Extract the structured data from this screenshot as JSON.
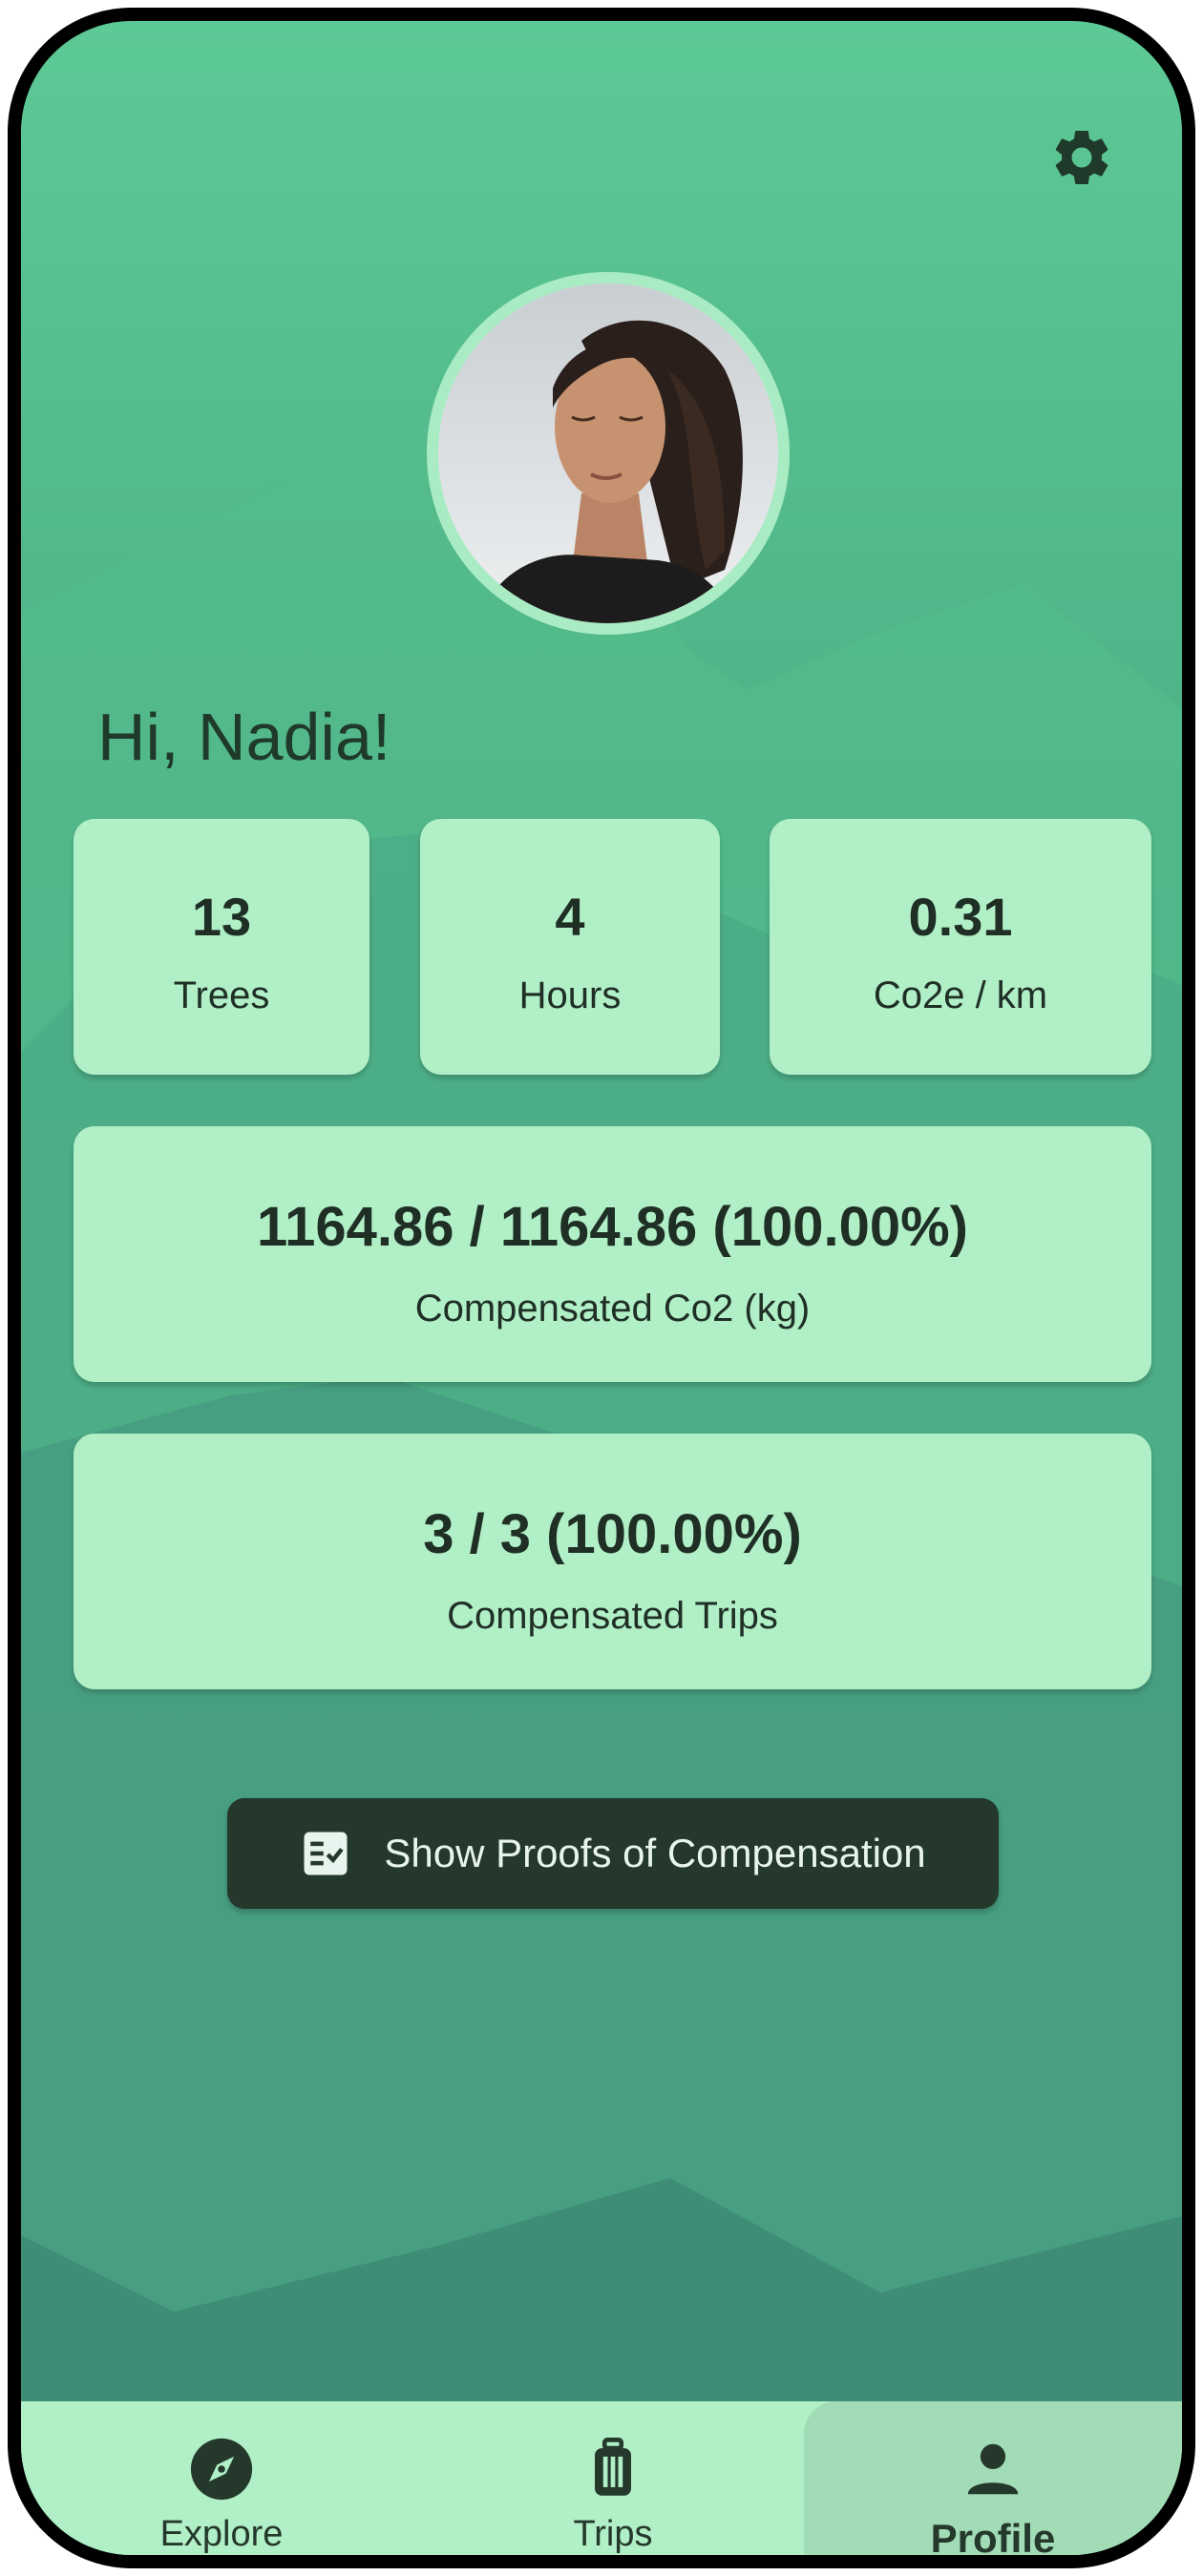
{
  "header": {
    "settings_icon": "gear-icon"
  },
  "profile": {
    "greeting": "Hi, Nadia!"
  },
  "stats": [
    {
      "value": "13",
      "label": "Trees"
    },
    {
      "value": "4",
      "label": "Hours"
    },
    {
      "value": "0.31",
      "label": "Co2e / km"
    }
  ],
  "co2": {
    "value": "1164.86 / 1164.86 (100.00%)",
    "label": "Compensated Co2 (kg)"
  },
  "trips_stat": {
    "value": "3 / 3 (100.00%)",
    "label": "Compensated Trips"
  },
  "proof_button": {
    "label": "Show Proofs of Compensation",
    "icon": "checklist-icon"
  },
  "nav": {
    "items": [
      {
        "label": "Explore",
        "icon": "compass-icon"
      },
      {
        "label": "Trips",
        "icon": "luggage-icon"
      },
      {
        "label": "Profile",
        "icon": "person-icon"
      }
    ],
    "active": "Profile"
  },
  "colors": {
    "accent": "#5dc995",
    "card": "#b1efc6",
    "dark": "#24382b"
  }
}
